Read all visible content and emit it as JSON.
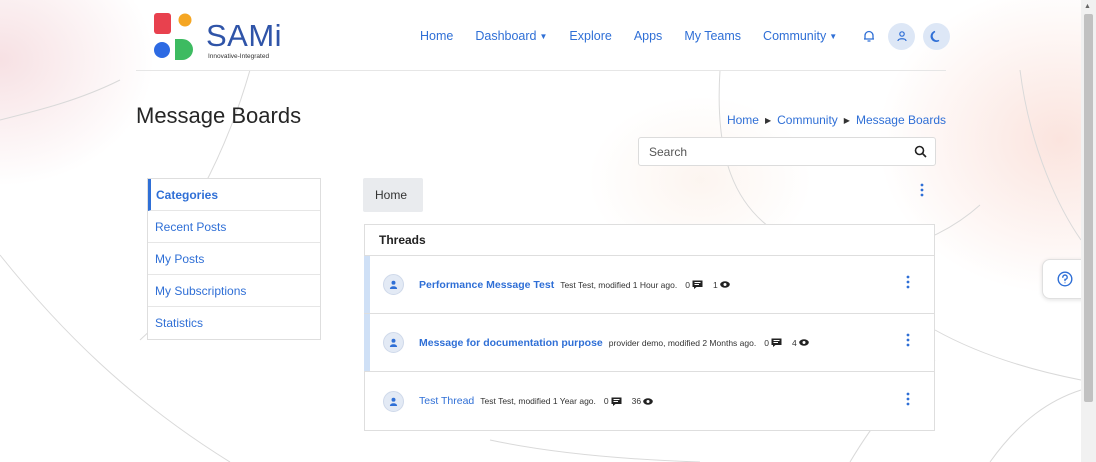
{
  "brand": {
    "name": "SAMi",
    "tagline": "Innovative-Integrated"
  },
  "nav": {
    "items": [
      {
        "label": "Home",
        "dropdown": false
      },
      {
        "label": "Dashboard",
        "dropdown": true
      },
      {
        "label": "Explore",
        "dropdown": false
      },
      {
        "label": "Apps",
        "dropdown": false
      },
      {
        "label": "My Teams",
        "dropdown": false
      },
      {
        "label": "Community",
        "dropdown": true
      }
    ],
    "icons": [
      "bell-icon",
      "user-icon",
      "moon-icon"
    ]
  },
  "page": {
    "title": "Message Boards"
  },
  "breadcrumb": [
    "Home",
    "Community",
    "Message Boards"
  ],
  "search": {
    "placeholder": "Search"
  },
  "sidebar": {
    "items": [
      {
        "label": "Categories",
        "active": true
      },
      {
        "label": "Recent Posts"
      },
      {
        "label": "My Posts"
      },
      {
        "label": "My Subscriptions"
      },
      {
        "label": "Statistics"
      }
    ]
  },
  "crumb_box": "Home",
  "threads": {
    "header": "Threads",
    "rows": [
      {
        "title": "Performance Message Test",
        "meta": "Test Test, modified 1 Hour ago.",
        "replies": "0",
        "views": "1",
        "unread": true
      },
      {
        "title": "Message for documentation purpose",
        "meta": "provider demo, modified 2 Months ago.",
        "replies": "0",
        "views": "4",
        "unread": true
      },
      {
        "title": "Test Thread",
        "meta": "Test Test, modified 1 Year ago.",
        "replies": "0",
        "views": "36",
        "unread": false
      }
    ]
  },
  "colors": {
    "accent": "#2f6fd6",
    "brand_blue": "#2f54a8",
    "logo_red": "#e8414e",
    "logo_orange": "#f5a623",
    "logo_green": "#3dbb61",
    "logo_blue": "#2d6ae3"
  }
}
